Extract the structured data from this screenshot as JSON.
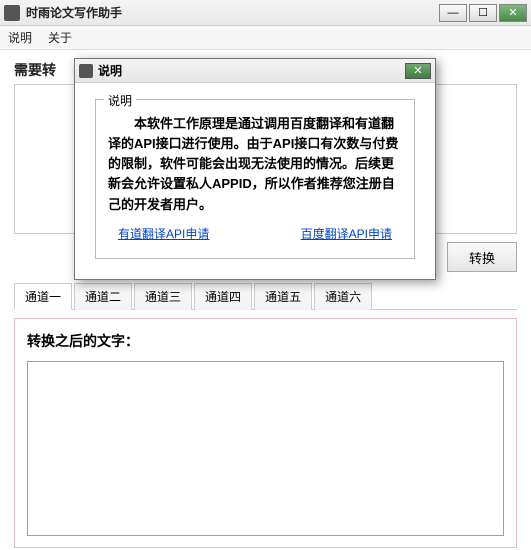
{
  "window": {
    "title": "时雨论文写作助手"
  },
  "menu": {
    "help": "说明",
    "about": "关于"
  },
  "main": {
    "input_label": "需要转",
    "convert_button": "转换",
    "output_label": "转换之后的文字：",
    "input_value": "",
    "output_value": ""
  },
  "tabs": [
    {
      "label": "通道一"
    },
    {
      "label": "通道二"
    },
    {
      "label": "通道三"
    },
    {
      "label": "通道四"
    },
    {
      "label": "通道五"
    },
    {
      "label": "通道六"
    }
  ],
  "dialog": {
    "title": "说明",
    "legend": "说明",
    "body": "本软件工作原理是通过调用百度翻译和有道翻译的API接口进行使用。由于API接口有次数与付费的限制，软件可能会出现无法使用的情况。后续更新会允许设置私人APPID，所以作者推荐您注册自己的开发者用户。",
    "link_youdao": "有道翻译API申请",
    "link_baidu": "百度翻译API申请"
  },
  "icons": {
    "minimize": "—",
    "maximize": "☐",
    "close": "✕",
    "modal_close": "✕"
  }
}
